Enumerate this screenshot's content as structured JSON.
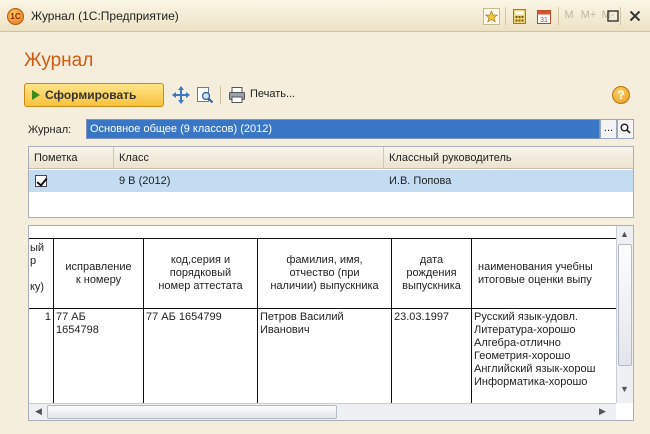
{
  "window": {
    "title": "Журнал (1С:Предприятие)",
    "app_icon_text": "1С",
    "mem_buttons": [
      "M",
      "M+",
      "M-"
    ]
  },
  "page": {
    "title": "Журнал"
  },
  "toolbar": {
    "generate_label": "Сформировать",
    "print_label": "Печать..."
  },
  "journal": {
    "label": "Журнал:",
    "value": "Основное общее (9 классов) (2012)",
    "select_button": "..."
  },
  "upper_table": {
    "headers": [
      "Пометка",
      "Класс",
      "Классный руководитель"
    ],
    "rows": [
      {
        "checked": true,
        "class": "9 В (2012)",
        "teacher": "И.В. Попова"
      }
    ]
  },
  "lower_grid": {
    "headers": [
      "ый\nр\n\nку)",
      "исправление\nк номеру",
      "код,серия и\nпорядковый\nномер аттестата",
      "фамилия, имя,\nотчество (при\nналичии) выпускника",
      "дата\nрождения\nвыпускника",
      "наименования учебны\nитоговые оценки выпу"
    ],
    "rows": [
      [
        "1",
        "77 АБ\n1654798",
        "77 АБ 1654799",
        "Петров Василий\nИванович",
        "23.03.1997",
        "Русский язык-удовл.\nЛитература-хорошо\nАлгебра-отлично\nГеометрия-хорошо\nАнглийский язык-хорош\nИнформатика-хорошо"
      ]
    ]
  },
  "colors": {
    "accent_orange": "#d25a12",
    "selection_blue": "#3a76c6",
    "row_highlight": "#c4dcf2",
    "button_yellow": "#f7c23c"
  }
}
